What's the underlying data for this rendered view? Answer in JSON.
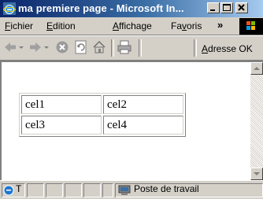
{
  "window": {
    "title": "ma premiere page - Microsoft In...",
    "icons": {
      "app": "ie-icon",
      "minimize": "minimize-icon",
      "maximize": "maximize-icon",
      "close": "close-icon"
    }
  },
  "menu": {
    "items": [
      {
        "label_pre": "",
        "label_ul": "F",
        "label_post": "ichier"
      },
      {
        "label_pre": "",
        "label_ul": "E",
        "label_post": "dition"
      },
      {
        "label_pre": "",
        "label_ul": "A",
        "label_post": "ffichage"
      },
      {
        "label_pre": "Fa",
        "label_ul": "v",
        "label_post": "oris"
      }
    ],
    "overflow": "»"
  },
  "toolbar": {
    "icons": [
      "back-icon",
      "forward-icon",
      "stop-icon",
      "refresh-icon",
      "home-icon",
      "print-icon"
    ],
    "address_ul": "A",
    "address_rest": "dresse",
    "ok_label": "OK"
  },
  "page": {
    "table": [
      [
        "cel1",
        "cel2"
      ],
      [
        "cel3",
        "cel4"
      ]
    ]
  },
  "statusbar": {
    "left_text": "T",
    "zone_text": "Poste de travail"
  }
}
